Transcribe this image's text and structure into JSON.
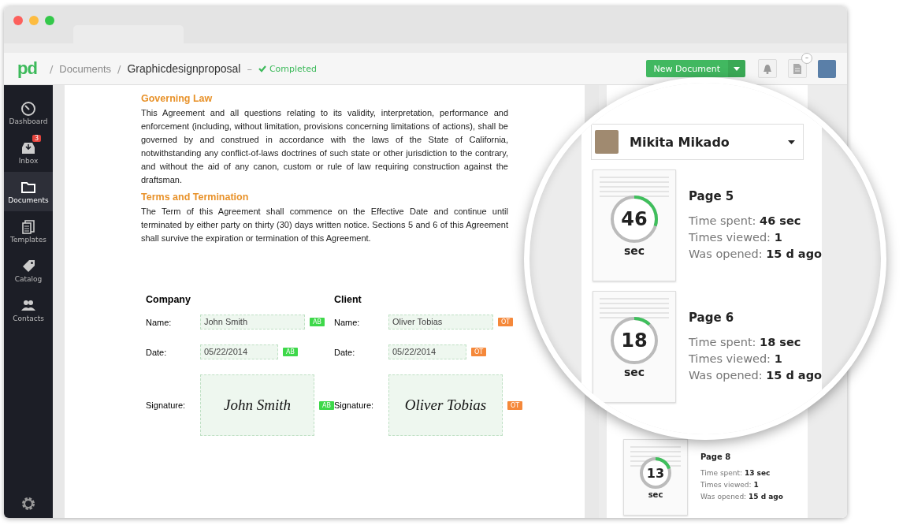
{
  "header": {
    "logo": "pd",
    "breadcrumb": [
      {
        "kind": "sep",
        "text": "/"
      },
      {
        "kind": "link",
        "text": "Documents"
      },
      {
        "kind": "sep",
        "text": "/"
      },
      {
        "kind": "current",
        "text": "Graphicdesignproposal"
      },
      {
        "kind": "sep",
        "text": "–"
      },
      {
        "kind": "status",
        "text": "Completed"
      }
    ],
    "new_button": "New Document",
    "doc_badge": "–"
  },
  "sidebar": {
    "items": [
      {
        "kind": "dashboard",
        "label": "Dashboard",
        "selected": false
      },
      {
        "kind": "inbox",
        "label": "Inbox",
        "selected": false,
        "badge": "3"
      },
      {
        "kind": "documents",
        "label": "Documents",
        "selected": true
      },
      {
        "kind": "templates",
        "label": "Templates",
        "selected": false
      },
      {
        "kind": "catalog",
        "label": "Catalog",
        "selected": false
      },
      {
        "kind": "contacts",
        "label": "Contacts",
        "selected": false
      }
    ]
  },
  "document": {
    "sections": [
      {
        "heading": "Governing Law",
        "text": "This Agreement and all questions relating to its validity, interpretation, performance and enforcement (including, without limitation, provisions concerning limitations of actions), shall be governed by and construed in accordance with the laws of the State of California, notwithstanding any conflict-of-laws doctrines of such state or other jurisdiction to the contrary, and without the aid of any canon, custom or rule of law requiring construction against the draftsman."
      },
      {
        "heading": "Terms and Termination",
        "text": "The Term of this Agreement shall commence on the Effective Date and continue until terminated by either party on thirty (30) days written notice. Sections 5 and 6 of this Agreement shall survive the expiration or termination of this Agreement."
      }
    ],
    "signers": [
      {
        "title": "Company",
        "color": "#3ed84a",
        "fields": [
          {
            "kind": "text",
            "label": "Name:",
            "value": "John Smith",
            "tag": "AB"
          },
          {
            "kind": "date",
            "label": "Date:",
            "value": "05/22/2014",
            "tag": "AB"
          },
          {
            "kind": "signature",
            "label": "Signature:",
            "value": "John Smith",
            "tag": "AB"
          }
        ]
      },
      {
        "title": "Client",
        "color": "#f5883a",
        "fields": [
          {
            "kind": "text",
            "label": "Name:",
            "value": "Oliver Tobias",
            "tag": "OT"
          },
          {
            "kind": "date",
            "label": "Date:",
            "value": "05/22/2014",
            "tag": "OT"
          },
          {
            "kind": "signature",
            "label": "Signature:",
            "value": "Oliver Tobias",
            "tag": "OT"
          }
        ]
      }
    ]
  },
  "magnifier": {
    "user": "Mikita Mikado",
    "pages": [
      {
        "title": "Page 5",
        "seconds": "46",
        "unit": "sec",
        "level": 0.3,
        "time_label": "Time spent:",
        "time": "46 sec",
        "views_label": "Times viewed:",
        "views": "1",
        "opened_label": "Was opened:",
        "opened": "15 d ago"
      },
      {
        "title": "Page 6",
        "seconds": "18",
        "unit": "sec",
        "level": 0.12,
        "time_label": "Time spent:",
        "time": "18 sec",
        "views_label": "Times viewed:",
        "views": "1",
        "opened_label": "Was opened:",
        "opened": "15 d ago"
      }
    ]
  },
  "analytics": {
    "pages": [
      {
        "title": "Page 8",
        "seconds": "13",
        "unit": "sec",
        "level": 0.2,
        "time_label": "Time spent:",
        "time": "13 sec",
        "views_label": "Times viewed:",
        "views": "1",
        "opened_label": "Was opened:",
        "opened": "15 d ago"
      }
    ]
  }
}
